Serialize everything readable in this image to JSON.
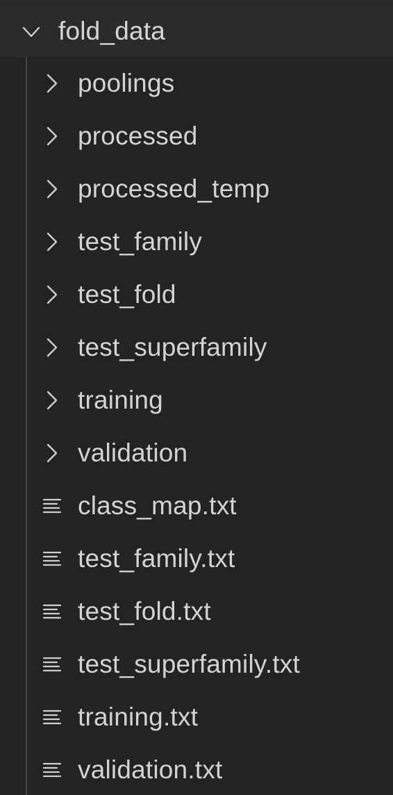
{
  "explorer": {
    "folder": {
      "name": "fold_data",
      "expanded": true,
      "icon": "chevron-down-icon"
    },
    "subfolders": [
      {
        "label": "poolings",
        "icon": "chevron-right-icon"
      },
      {
        "label": "processed",
        "icon": "chevron-right-icon"
      },
      {
        "label": "processed_temp",
        "icon": "chevron-right-icon"
      },
      {
        "label": "test_family",
        "icon": "chevron-right-icon"
      },
      {
        "label": "test_fold",
        "icon": "chevron-right-icon"
      },
      {
        "label": "test_superfamily",
        "icon": "chevron-right-icon"
      },
      {
        "label": "training",
        "icon": "chevron-right-icon"
      },
      {
        "label": "validation",
        "icon": "chevron-right-icon"
      }
    ],
    "files": [
      {
        "label": "class_map.txt",
        "icon": "text-file-icon"
      },
      {
        "label": "test_family.txt",
        "icon": "text-file-icon"
      },
      {
        "label": "test_fold.txt",
        "icon": "text-file-icon"
      },
      {
        "label": "test_superfamily.txt",
        "icon": "text-file-icon"
      },
      {
        "label": "training.txt",
        "icon": "text-file-icon"
      },
      {
        "label": "validation.txt",
        "icon": "text-file-icon"
      }
    ]
  },
  "colors": {
    "background": "#232325",
    "header_background": "#2b2b2e",
    "text": "#d3d3d5",
    "guide_line": "#48484c"
  }
}
